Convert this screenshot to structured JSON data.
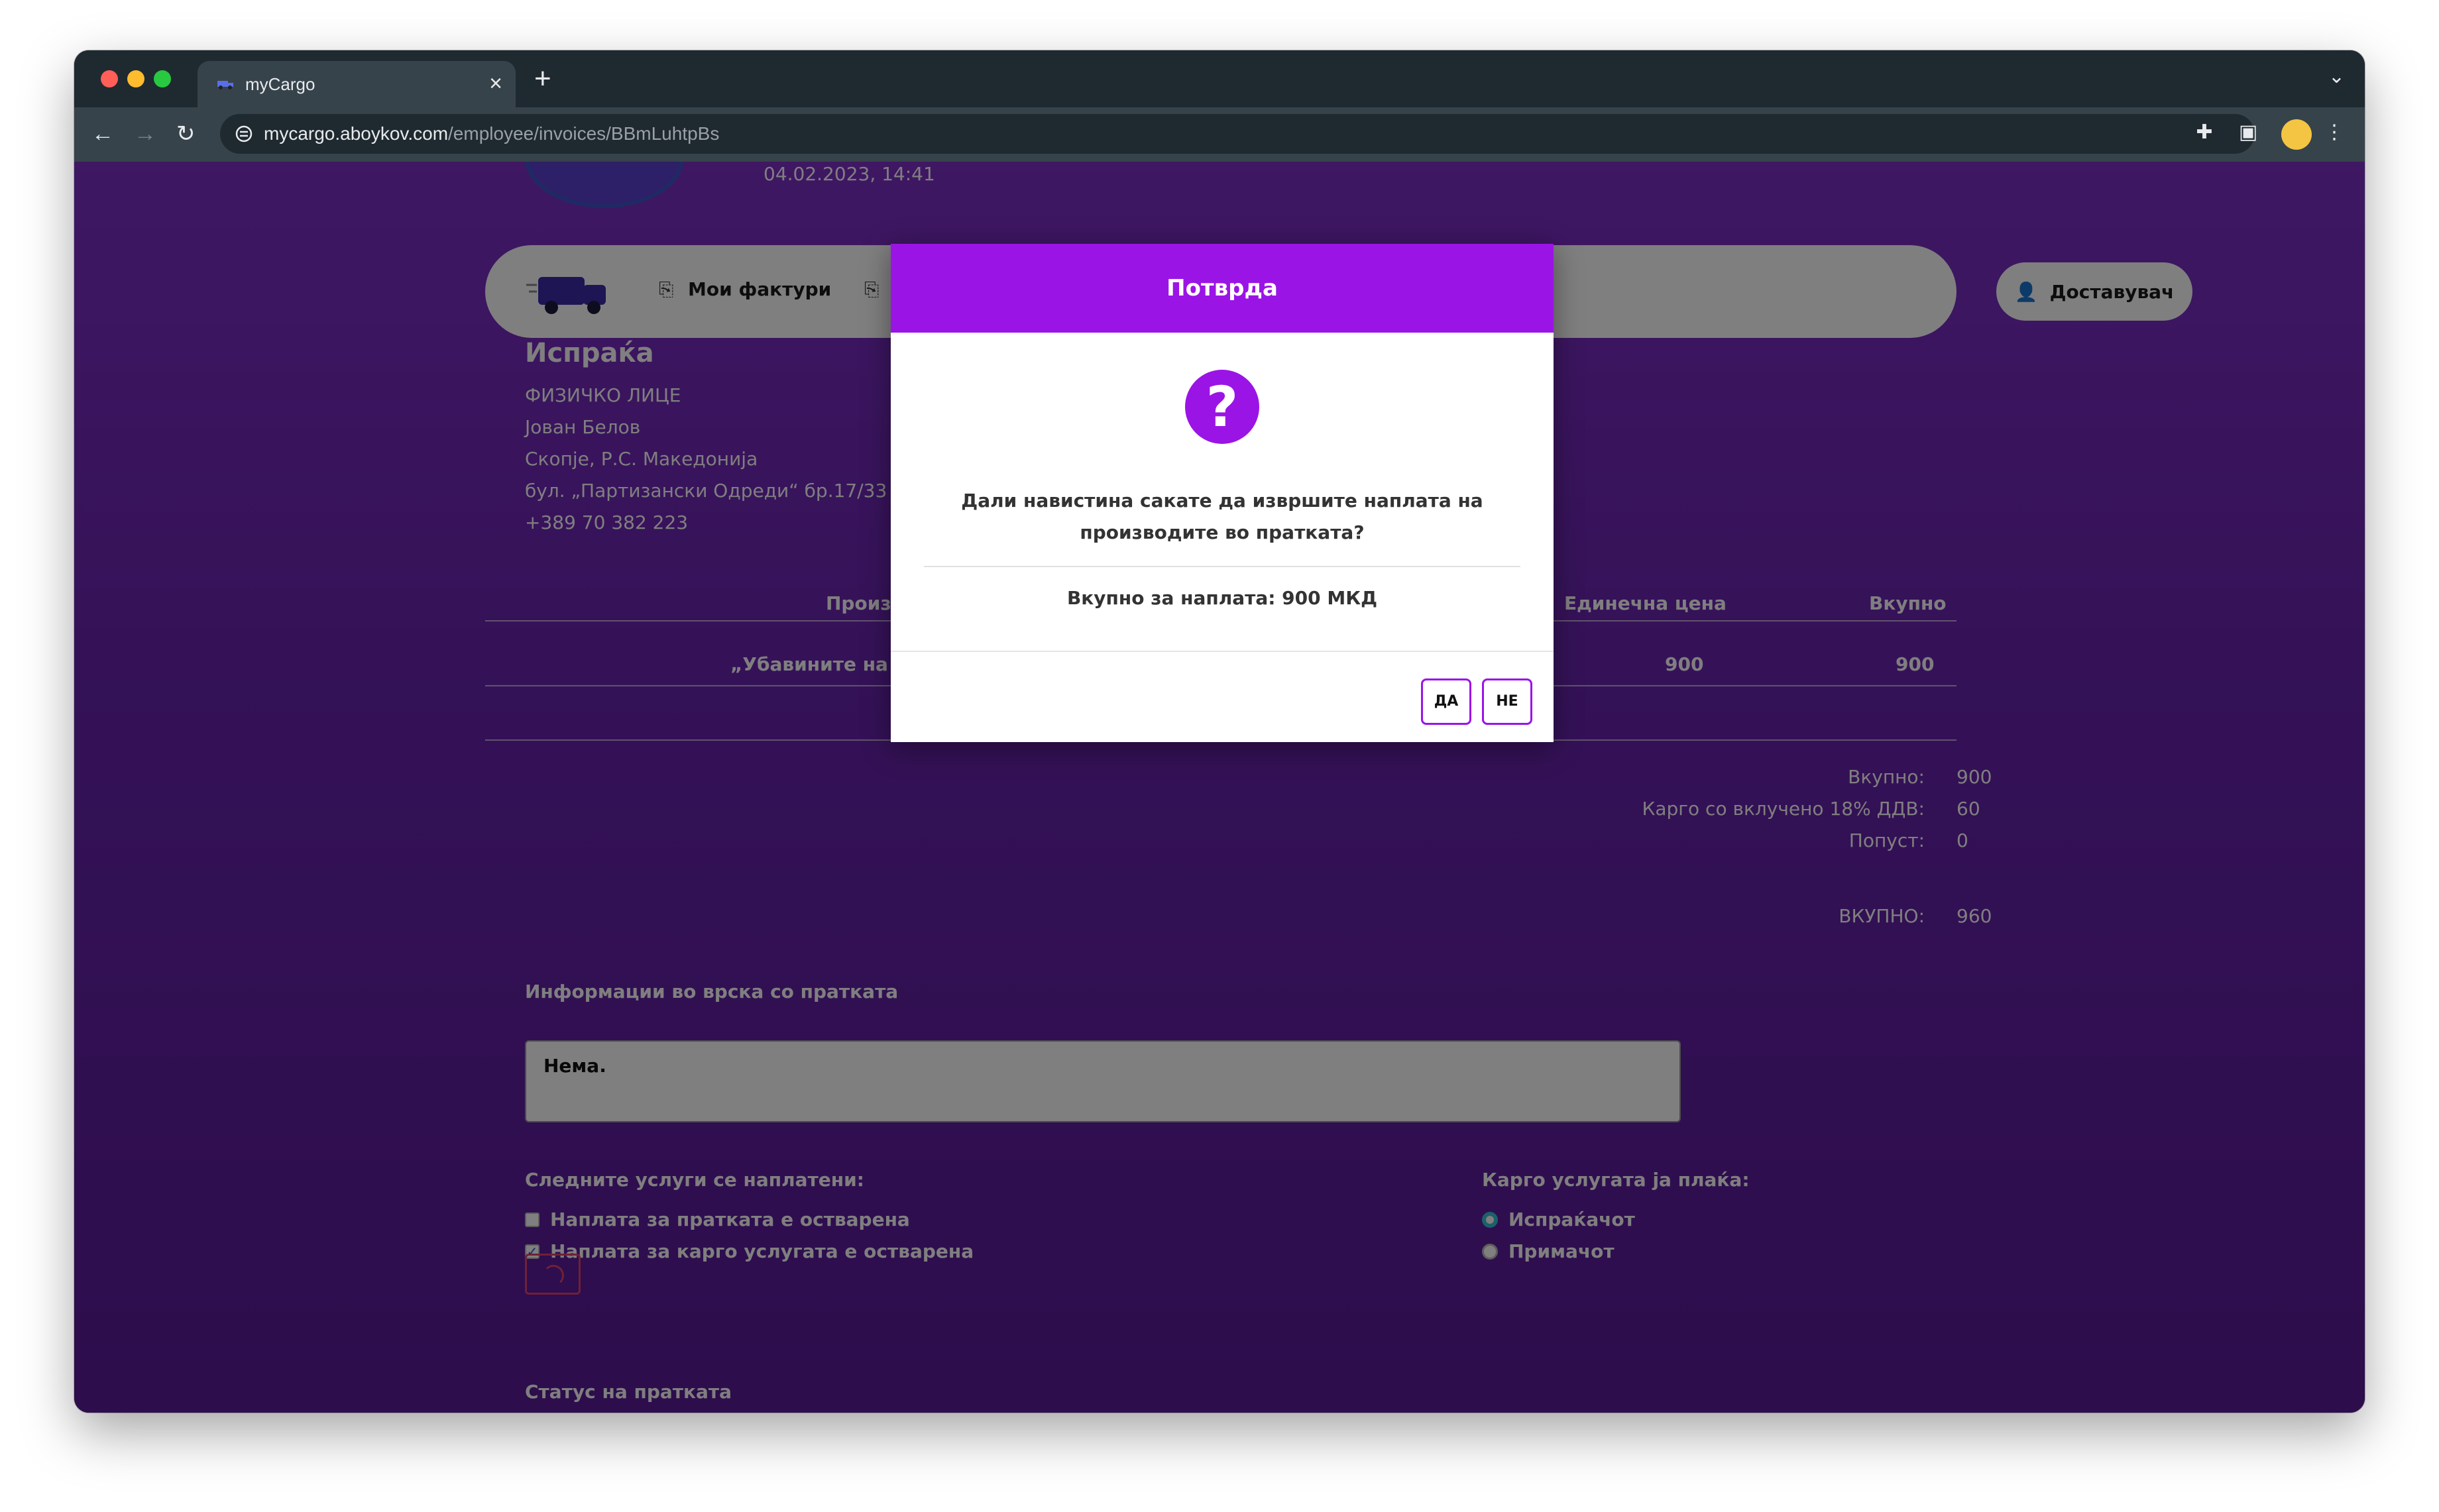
{
  "browser": {
    "tab_title": "myCargo",
    "url_host": "mycargo.aboykov.com",
    "url_path": "/employee/invoices/BBmLuhtpBs",
    "new_tab": "+",
    "close_tab": "×"
  },
  "header": {
    "date": "04.02.2023, 14:41",
    "nav_items": [
      "Мои фактури"
    ],
    "role_button": "Доставувач"
  },
  "sender": {
    "title": "Испраќа",
    "lines": [
      "ФИЗИЧКО ЛИЦЕ",
      "Јован Белов",
      "Скопје, Р.С. Македонија",
      "бул. „Партизански Одреди“ бр.17/33",
      "+389 70 382 223"
    ]
  },
  "table": {
    "headers": [
      "Произ",
      "Единечна цена",
      "Вкупно"
    ],
    "row": {
      "product": "„Убавините на св",
      "unit_price": "900",
      "total": "900"
    }
  },
  "summary": {
    "total_label": "Вкупно:",
    "total_value": "900",
    "cargo_label": "Карго со вклучено 18% ДДВ:",
    "cargo_value": "60",
    "discount_label": "Попуст:",
    "discount_value": "0",
    "grand_label": "ВКУПНО:",
    "grand_value": "960"
  },
  "info": {
    "label": "Информации во врска со пратката",
    "value": "Нема."
  },
  "services": {
    "label": "Следните услуги се наплатени:",
    "items": [
      {
        "label": "Наплата за пратката е остварена",
        "checked": false
      },
      {
        "label": "Наплата за карго услугата е остварена",
        "checked": true
      }
    ]
  },
  "payer": {
    "label": "Карго услугата ја плаќа:",
    "options": [
      {
        "label": "Испраќачот",
        "selected": true
      },
      {
        "label": "Примачот",
        "selected": false
      }
    ]
  },
  "status": {
    "label": "Статус на пратката"
  },
  "modal": {
    "title": "Потврда",
    "icon": "?",
    "question": "Дали навистина сакате да извршите наплата на производите во пратката?",
    "total": "Вкупно за наплата: 900 МКД",
    "yes": "ДА",
    "no": "НЕ"
  },
  "colors": {
    "accent": "#9b14e6",
    "page_bg": "#6a24b0"
  }
}
